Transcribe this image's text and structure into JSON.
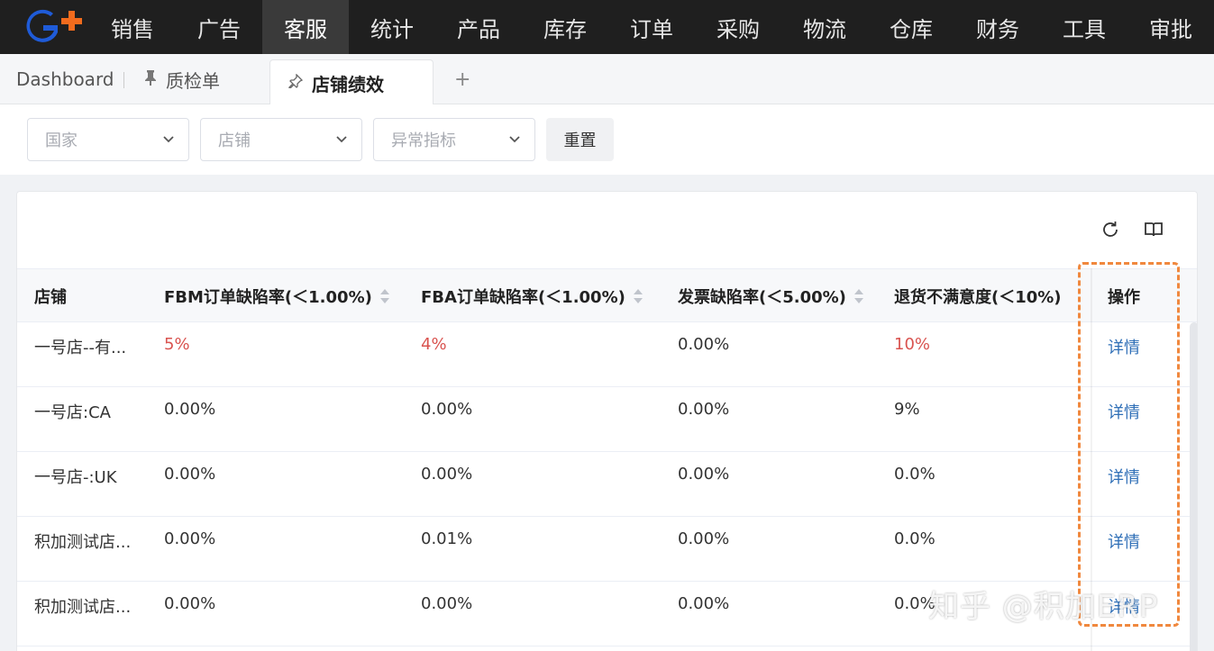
{
  "nav": {
    "items": [
      "销售",
      "广告",
      "客服",
      "统计",
      "产品",
      "库存",
      "订单",
      "采购",
      "物流",
      "仓库",
      "财务",
      "工具",
      "审批"
    ],
    "active": "客服"
  },
  "tabs": {
    "dashboard": "Dashboard",
    "qc": "质检单",
    "active": "店铺绩效",
    "add": "+"
  },
  "filters": {
    "country_placeholder": "国家",
    "store_placeholder": "店铺",
    "metric_placeholder": "异常指标",
    "reset_label": "重置"
  },
  "table": {
    "headers": {
      "store": "店铺",
      "fbm": "FBM订单缺陷率(＜1.00%)",
      "fba": "FBA订单缺陷率(＜1.00%)",
      "invoice": "发票缺陷率(＜5.00%)",
      "returns": "退货不满意度(＜10%)",
      "action": "操作"
    },
    "rows": [
      {
        "store": "一号店--有...",
        "fbm": "5%",
        "fba": "4%",
        "invoice": "0.00%",
        "returns": "10%",
        "action": "详情"
      },
      {
        "store": "一号店:CA",
        "fbm": "0.00%",
        "fba": "0.00%",
        "invoice": "0.00%",
        "returns": "9%",
        "action": "详情"
      },
      {
        "store": "一号店-:UK",
        "fbm": "0.00%",
        "fba": "0.00%",
        "invoice": "0.00%",
        "returns": "0.0%",
        "action": "详情"
      },
      {
        "store": "积加测试店...",
        "fbm": "0.00%",
        "fba": "0.01%",
        "invoice": "0.00%",
        "returns": "0.0%",
        "action": "详情"
      },
      {
        "store": "积加测试店...",
        "fbm": "0.00%",
        "fba": "0.00%",
        "invoice": "0.00%",
        "returns": "0.0%",
        "action": "详情"
      }
    ]
  },
  "watermark": "知乎 @积加ERP",
  "colors": {
    "nav_bg": "#1f1f1f",
    "logo_blue": "#1f5bd8",
    "logo_orange": "#f26b1d",
    "alert_red": "#d9534f",
    "link_blue": "#2f6fb7",
    "highlight_orange": "#f0883e"
  }
}
